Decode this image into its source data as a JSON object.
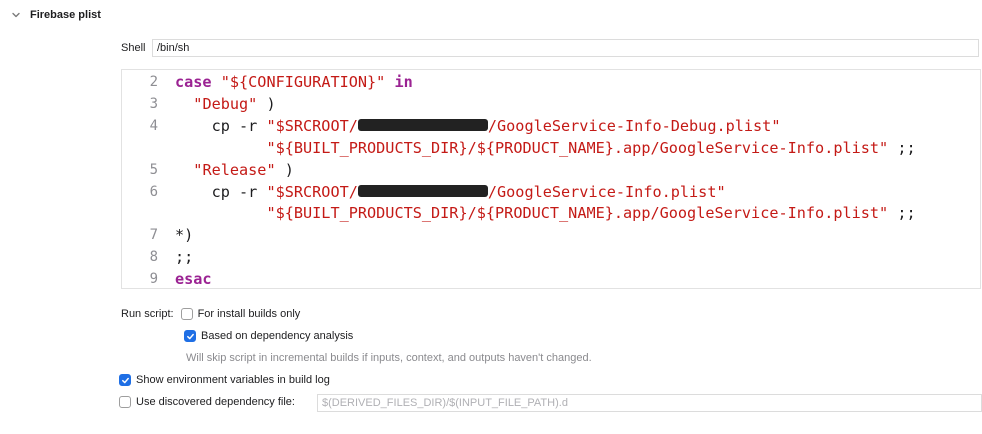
{
  "section": {
    "title": "Firebase plist",
    "chevron_icon": "chevron-down-icon"
  },
  "shell": {
    "label": "Shell",
    "value": "/bin/sh"
  },
  "script_lines": [
    {
      "num": "2",
      "parts": [
        {
          "t": "case",
          "c": "kw"
        },
        {
          "t": " "
        },
        {
          "t": "\"${CONFIGURATION}\"",
          "c": "str"
        },
        {
          "t": " "
        },
        {
          "t": "in",
          "c": "kw"
        }
      ]
    },
    {
      "num": "3",
      "parts": [
        {
          "t": "  "
        },
        {
          "t": "\"Debug\"",
          "c": "str"
        },
        {
          "t": " )"
        }
      ]
    },
    {
      "num": "4",
      "parts": [
        {
          "t": "    cp -r "
        },
        {
          "t": "\"$SRCROOT/",
          "c": "str"
        },
        {
          "t": "",
          "c": "redact"
        },
        {
          "t": "/GoogleService-Info-Debug.plist\"",
          "c": "str"
        }
      ]
    },
    {
      "num": "",
      "parts": [
        {
          "t": "          "
        },
        {
          "t": "\"${BUILT_PRODUCTS_DIR}/${PRODUCT_NAME}.app/GoogleService-Info.plist\"",
          "c": "str"
        },
        {
          "t": " ;;"
        }
      ]
    },
    {
      "num": "5",
      "parts": [
        {
          "t": "  "
        },
        {
          "t": "\"Release\"",
          "c": "str"
        },
        {
          "t": " )"
        }
      ]
    },
    {
      "num": "6",
      "parts": [
        {
          "t": "    cp -r "
        },
        {
          "t": "\"$SRCROOT/",
          "c": "str"
        },
        {
          "t": "",
          "c": "redact"
        },
        {
          "t": "/GoogleService-Info.plist\"",
          "c": "str"
        }
      ]
    },
    {
      "num": "",
      "parts": [
        {
          "t": "          "
        },
        {
          "t": "\"${BUILT_PRODUCTS_DIR}/${PRODUCT_NAME}.app/GoogleService-Info.plist\"",
          "c": "str"
        },
        {
          "t": " ;;"
        }
      ]
    },
    {
      "num": "7",
      "parts": [
        {
          "t": "*)"
        }
      ]
    },
    {
      "num": "8",
      "parts": [
        {
          "t": ";;"
        }
      ]
    },
    {
      "num": "9",
      "parts": [
        {
          "t": "esac",
          "c": "kw"
        }
      ]
    }
  ],
  "run_script": {
    "label": "Run script:",
    "install_builds": {
      "label": "For install builds only",
      "checked": false
    },
    "dependency_analysis": {
      "label": "Based on dependency analysis",
      "checked": true
    },
    "hint": "Will skip script in incremental builds if inputs, context, and outputs haven't changed."
  },
  "show_env": {
    "label": "Show environment variables in build log",
    "checked": true
  },
  "discovered_dep": {
    "label": "Use discovered dependency file:",
    "checked": false,
    "placeholder": "$(DERIVED_FILES_DIR)/$(INPUT_FILE_PATH).d"
  },
  "colors": {
    "keyword": "#9b2393",
    "string": "#c41a16",
    "accent": "#1f6fe5"
  }
}
